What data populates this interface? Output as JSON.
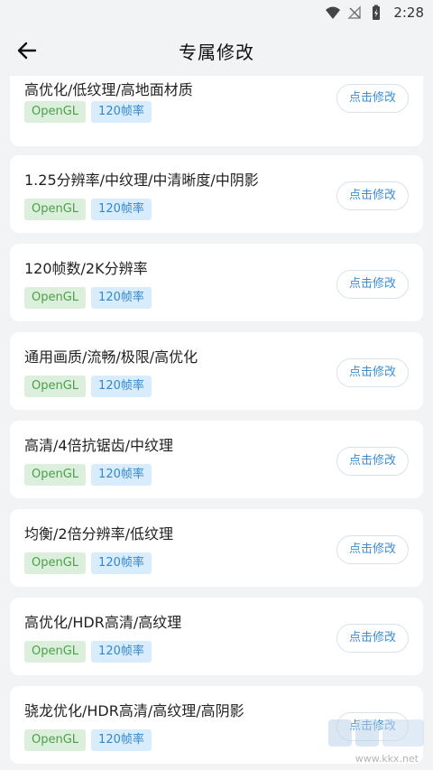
{
  "status_bar": {
    "time": "2:28"
  },
  "header": {
    "title": "专属修改"
  },
  "items": [
    {
      "title": "高优化/低纹理/高地面材质",
      "tags": [
        "OpenGL",
        "120帧率"
      ],
      "button": "点击修改"
    },
    {
      "title": "1.25分辨率/中纹理/中清晰度/中阴影",
      "tags": [
        "OpenGL",
        "120帧率"
      ],
      "button": "点击修改"
    },
    {
      "title": "120帧数/2K分辨率",
      "tags": [
        "OpenGL",
        "120帧率"
      ],
      "button": "点击修改"
    },
    {
      "title": "通用画质/流畅/极限/高优化",
      "tags": [
        "OpenGL",
        "120帧率"
      ],
      "button": "点击修改"
    },
    {
      "title": "高清/4倍抗锯齿/中纹理",
      "tags": [
        "OpenGL",
        "120帧率"
      ],
      "button": "点击修改"
    },
    {
      "title": "均衡/2倍分辨率/低纹理",
      "tags": [
        "OpenGL",
        "120帧率"
      ],
      "button": "点击修改"
    },
    {
      "title": "高优化/HDR高清/高纹理",
      "tags": [
        "OpenGL",
        "120帧率"
      ],
      "button": "点击修改"
    },
    {
      "title": "骁龙优化/HDR高清/高纹理/高阴影",
      "tags": [
        "OpenGL",
        "120帧率"
      ],
      "button": "点击修改"
    }
  ],
  "watermark": {
    "text": "www.kkx.net"
  }
}
